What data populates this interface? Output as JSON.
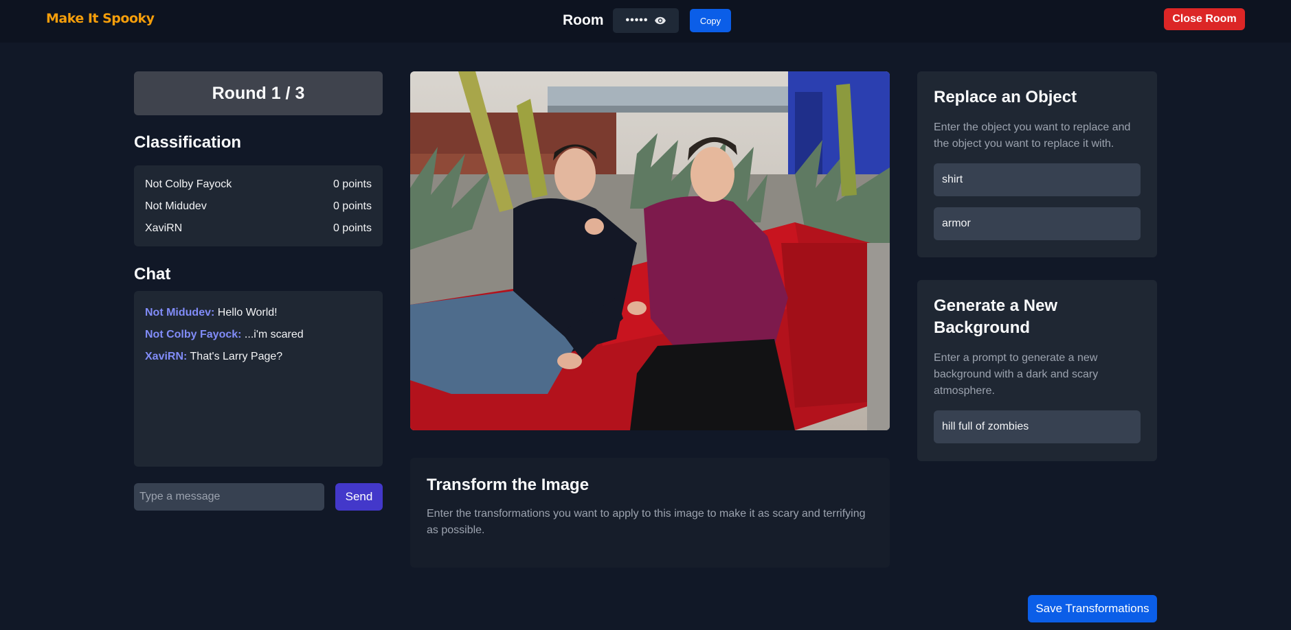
{
  "header": {
    "logo": "Make It Spooky",
    "room_label": "Room",
    "room_code_masked": "•••••",
    "copy_label": "Copy",
    "close_room_label": "Close Room"
  },
  "round": {
    "label": "Round 1 / 3"
  },
  "classification": {
    "title": "Classification",
    "rows": [
      {
        "name": "Not Colby Fayock",
        "points": "0 points"
      },
      {
        "name": "Not Midudev",
        "points": "0 points"
      },
      {
        "name": "XaviRN",
        "points": "0 points"
      }
    ]
  },
  "chat": {
    "title": "Chat",
    "messages": [
      {
        "user": "Not Midudev:",
        "text": "Hello World!"
      },
      {
        "user": "Not Colby Fayock:",
        "text": "...i'm scared"
      },
      {
        "user": "XaviRN:",
        "text": "That's Larry Page?"
      }
    ],
    "input_placeholder": "Type a message",
    "send_label": "Send"
  },
  "transform": {
    "title": "Transform the Image",
    "description": "Enter the transformations you want to apply to this image to make it as scary and terrifying as possible."
  },
  "replace": {
    "title": "Replace an Object",
    "description": "Enter the object you want to replace and the object you want to replace it with.",
    "from_value": "shirt",
    "to_value": "armor"
  },
  "background": {
    "title": "Generate a New Background",
    "description": "Enter a prompt to generate a new background with a dark and scary atmosphere.",
    "prompt_value": "hill full of zombies"
  },
  "footer": {
    "save_label": "Save Transformations"
  },
  "colors": {
    "accent_blue": "#0b5ee8",
    "danger_red": "#dc2626",
    "logo_orange": "#f59e0b",
    "chat_user": "#818cf8",
    "send_purple": "#4338ca"
  }
}
